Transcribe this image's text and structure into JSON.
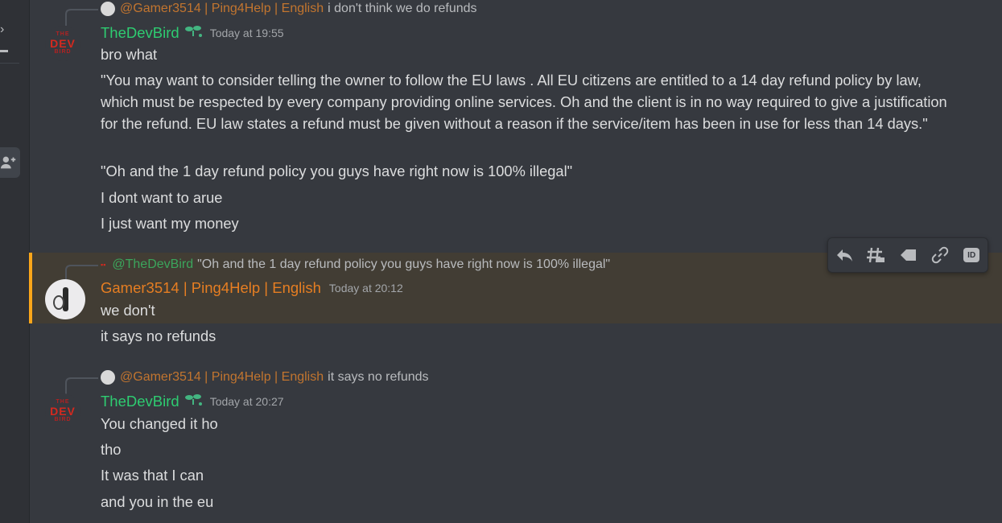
{
  "messages": [
    {
      "reply_to_user": "@Gamer3514 | Ping4Help | English",
      "reply_text": "i don't think we do refunds",
      "author": "TheDevBird",
      "timestamp": "Today at 19:55",
      "lines": [
        "bro what",
        "\"You may want to consider telling the owner to follow the EU laws . All EU citizens are entitled to a 14 day refund policy by law, which must be respected by every company providing online services. Oh and the client is in no way required to give a justification for the refund. EU law states a refund must be given without a reason if the service/item has been in use for less than 14 days.\"",
        "\"Oh and the 1 day refund policy you guys have right now is 100% illegal\"",
        "I dont want to arue",
        "I just want my money"
      ]
    },
    {
      "reply_to_user": "@TheDevBird",
      "reply_text": "\"Oh and the 1 day refund policy you guys have right now is 100% illegal\"",
      "author": "Gamer3514 | Ping4Help | English",
      "timestamp": "Today at 20:12",
      "lines": [
        "we don't",
        "it says no refunds"
      ]
    },
    {
      "reply_to_user": "@Gamer3514 | Ping4Help | English",
      "reply_text": "it says no refunds",
      "author": "TheDevBird",
      "timestamp": "Today at 20:27",
      "lines": [
        "You changed it ho",
        "tho",
        "It was that I can",
        "and you in the eu"
      ]
    }
  ],
  "avatar_text": {
    "top": "THE",
    "mid": "DEV",
    "bottom": "BIRD"
  },
  "toolbar": {
    "id_label": "ID"
  },
  "icons": {
    "reply": "reply-arrow-icon",
    "thread": "thread-icon",
    "tag": "tag-icon",
    "link": "link-icon",
    "badge": "sprout-badge-icon"
  },
  "colors": {
    "dev_name": "#2ecc71",
    "gamer_name": "#e67e22",
    "highlight_bar": "#faa61a"
  }
}
